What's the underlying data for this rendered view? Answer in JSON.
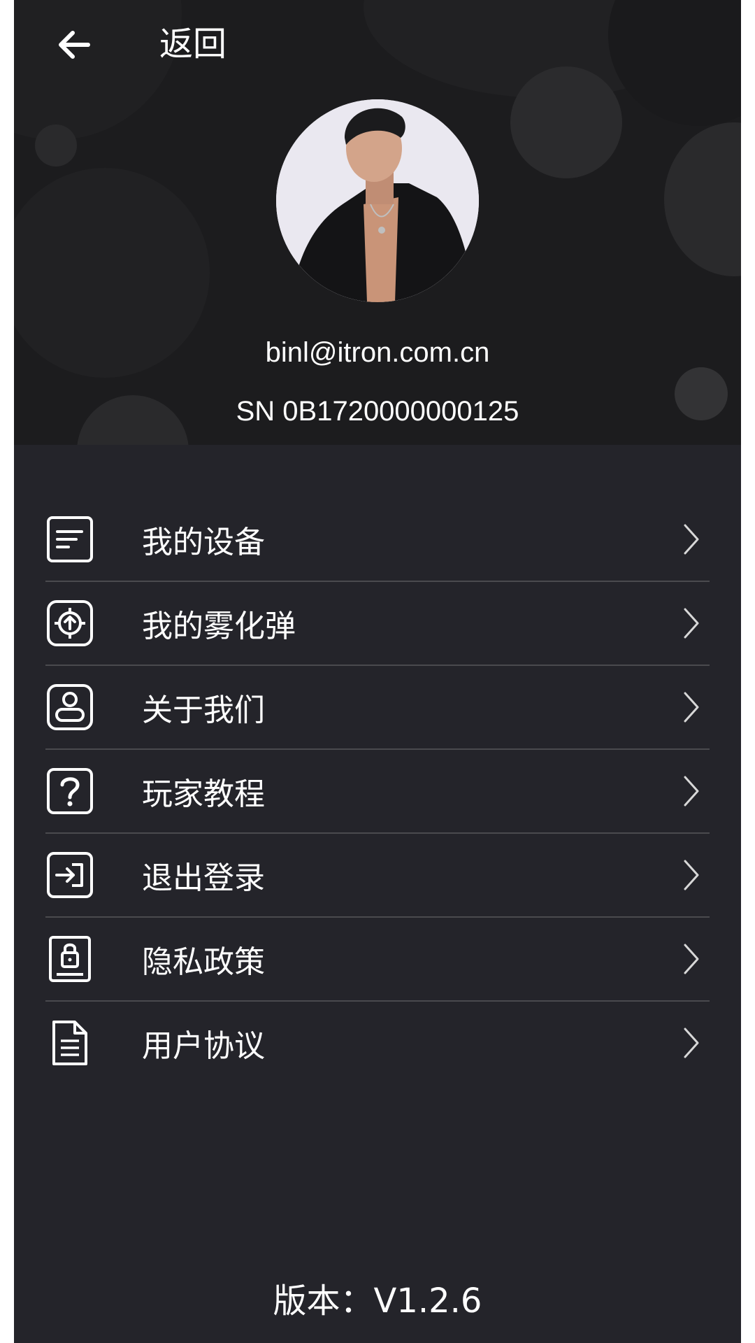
{
  "header": {
    "back_label": "返回",
    "email": "binl@itron.com.cn",
    "serial": "SN 0B1720000000125"
  },
  "menu": {
    "items": [
      {
        "label": "我的设备",
        "icon": "device-icon"
      },
      {
        "label": "我的雾化弹",
        "icon": "atomizer-chip-icon"
      },
      {
        "label": "关于我们",
        "icon": "about-user-icon"
      },
      {
        "label": "玩家教程",
        "icon": "help-question-icon"
      },
      {
        "label": "退出登录",
        "icon": "logout-icon"
      },
      {
        "label": "隐私政策",
        "icon": "privacy-lock-icon"
      },
      {
        "label": "用户协议",
        "icon": "document-icon"
      }
    ]
  },
  "footer": {
    "version": "版本：V1.2.6"
  }
}
